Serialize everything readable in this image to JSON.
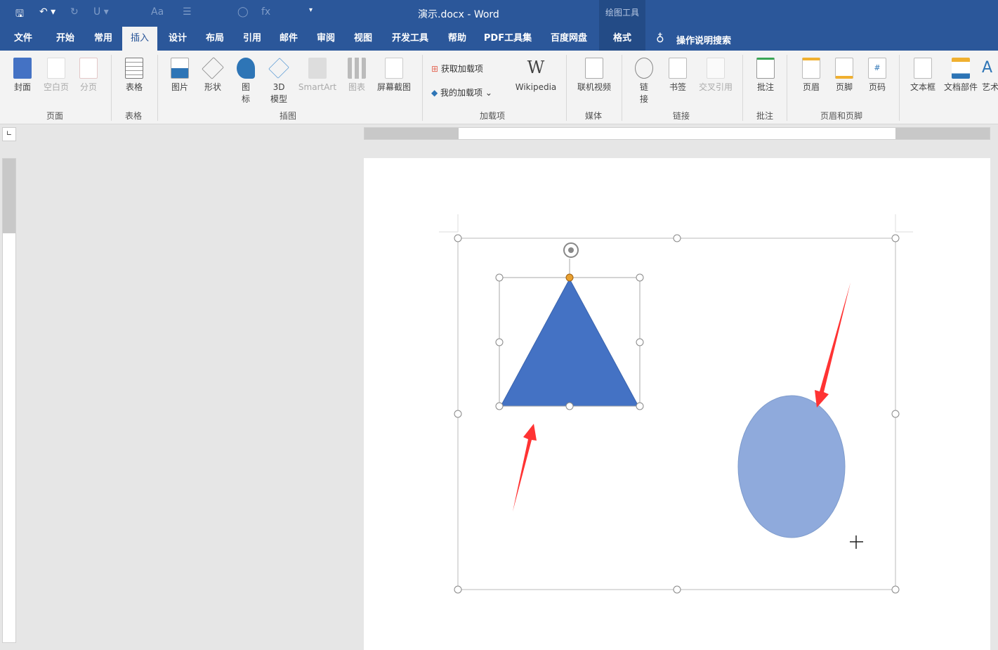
{
  "window": {
    "title": "演示.docx  -  Word",
    "context_tab_group": "绘图工具"
  },
  "quick_access": {
    "save": "save-icon",
    "undo": "undo-icon",
    "redo": "redo-icon"
  },
  "tabs": [
    "文件",
    "开始",
    "常用",
    "插入",
    "设计",
    "布局",
    "引用",
    "邮件",
    "审阅",
    "视图",
    "开发工具",
    "帮助",
    "PDF工具集",
    "百度网盘",
    "格式"
  ],
  "active_tab": "插入",
  "search": {
    "label": "操作说明搜索"
  },
  "ribbon": {
    "groups": [
      {
        "label": "页面",
        "items": [
          "封面",
          "空白页",
          "分页"
        ]
      },
      {
        "label": "表格",
        "items": [
          "表格"
        ]
      },
      {
        "label": "插图",
        "items": [
          "图片",
          "形状",
          "图\n标",
          "3D\n模型",
          "SmartArt",
          "图表",
          "屏幕截图"
        ]
      },
      {
        "label": "加载项",
        "items": [
          "获取加载项",
          "我的加载项",
          "Wikipedia"
        ]
      },
      {
        "label": "媒体",
        "items": [
          "联机视频"
        ]
      },
      {
        "label": "链接",
        "items": [
          "链\n接",
          "书签",
          "交叉引用"
        ]
      },
      {
        "label": "批注",
        "items": [
          "批注"
        ]
      },
      {
        "label": "页眉和页脚",
        "items": [
          "页眉",
          "页脚",
          "页码"
        ]
      },
      {
        "label": "",
        "items": [
          "文本框",
          "文档部件",
          "艺术"
        ]
      }
    ]
  },
  "colors": {
    "brand": "#2b579a",
    "triangle": "#4472c4",
    "ellipse": "#8faadc",
    "arrow": "#ff3333",
    "handle_adjust": "#e8a030"
  }
}
